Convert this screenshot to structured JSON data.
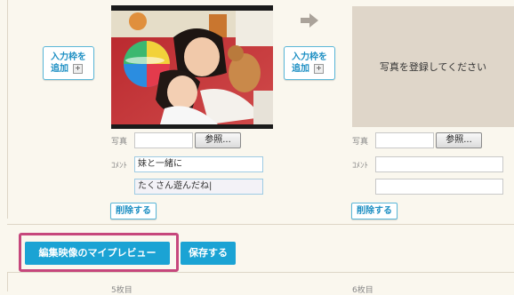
{
  "slot1": {
    "add_button": {
      "line1": "入力枠を",
      "line2": "追加",
      "plus": "+"
    },
    "photo_label": "写真",
    "browse_label": "参照...",
    "comment_label": "ｺﾒﾝﾄ",
    "comment_line1": "妹と一緒に",
    "comment_line2": "たくさん遊んだね|",
    "delete_label": "削除する"
  },
  "slot2": {
    "add_button": {
      "line1": "入力枠を",
      "line2": "追加",
      "plus": "+"
    },
    "placeholder": "写真を登録してください",
    "photo_label": "写真",
    "browse_label": "参照...",
    "comment_label": "ｺﾒﾝﾄ",
    "delete_label": "削除する"
  },
  "actions": {
    "preview_label": "編集映像のマイプレビュー",
    "save_label": "保存する"
  },
  "next_row": {
    "left": "5枚目",
    "right": "6枚目"
  },
  "colors": {
    "accent": "#1ba3d4",
    "highlight": "#c6477c",
    "placeholder_bg": "#dfd6c9"
  }
}
